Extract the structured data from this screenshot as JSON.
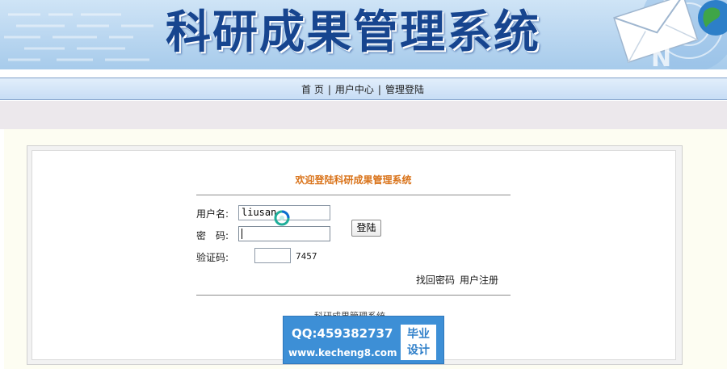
{
  "banner": {
    "title": "科研成果管理系统"
  },
  "nav": {
    "items": [
      {
        "label": "首 页"
      },
      {
        "label": "用户中心"
      },
      {
        "label": "管理登陆"
      }
    ],
    "separator": "|"
  },
  "login": {
    "title": "欢迎登陆科研成果管理系统",
    "username_label": "用户名:",
    "username_value": "liusan",
    "password_label": "密　码:",
    "password_value": "",
    "captcha_label": "验证码:",
    "captcha_value": "",
    "captcha_code": "7457",
    "submit_label": "登陆",
    "recover_link": "找回密码",
    "register_link": "用户注册"
  },
  "footer": {
    "text": "科研成果管理系统"
  },
  "watermark": {
    "qq": "QQ:459382737",
    "url": "www.kecheng8.com",
    "stamp_line1": "毕业",
    "stamp_line2": "设计"
  },
  "colors": {
    "title_orange": "#d9731a",
    "banner_title_blue": "#17458f",
    "nav_bg": "#c7ddf5",
    "watermark_blue": "#3d8fd6"
  }
}
